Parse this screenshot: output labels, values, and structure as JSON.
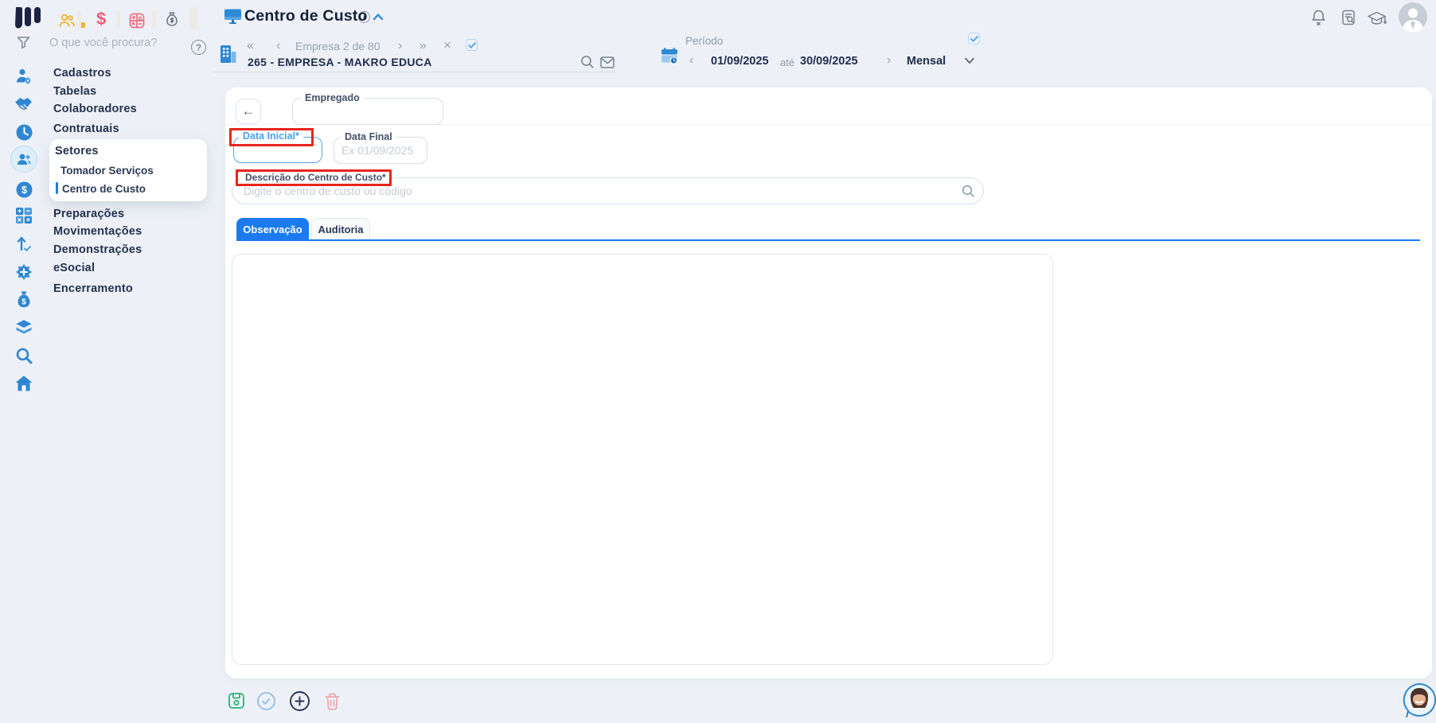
{
  "colors": {
    "accent_blue": "#1b7af0",
    "icon_blue": "#2f87d3",
    "annotation_red": "#e8241c",
    "focus_blue": "#54a3e8",
    "save_green": "#27b578",
    "delete_pink": "#f2a7ae",
    "topbar_yellow": "#f3b229",
    "topbar_pink": "#f0607a",
    "navy": "#1f2c4d",
    "page_bg": "#edf1f7"
  },
  "glyphs": {
    "first": "«",
    "prev": "‹",
    "next": "›",
    "last": "»",
    "close": "×",
    "back": "←",
    "dollar": "$",
    "question": "?",
    "info": "i"
  },
  "sidebar": {
    "search_placeholder": "O que você procura?",
    "items_top": [
      "Cadastros",
      "Tabelas",
      "Colaboradores",
      "Contratuais"
    ],
    "setores": {
      "label": "Setores",
      "children": [
        "Tomador Serviços",
        "Centro de Custo"
      ],
      "active_child": "Centro de Custo"
    },
    "items_bottom": [
      "Preparações",
      "Movimentações",
      "Demonstrações",
      "eSocial",
      "Encerramento"
    ]
  },
  "header": {
    "title": "Centro de Custo",
    "company": {
      "position": "Empresa 2 de 80",
      "name": "265 - EMPRESA - MAKRO EDUCA"
    },
    "period": {
      "label": "Período",
      "start": "01/09/2025",
      "until": "até",
      "end": "30/09/2025",
      "mode": "Mensal"
    }
  },
  "form": {
    "empregado_label": "Empregado",
    "data_inicial_label": "Data Inicial*",
    "data_inicial_value": "",
    "data_final_label": "Data Final",
    "data_final_placeholder": "Ex 01/09/2025",
    "descricao_label": "Descrição do Centro de Custo*",
    "descricao_placeholder": "Digite o centro de custo ou código"
  },
  "tabs": [
    {
      "label": "Observação",
      "active": true
    },
    {
      "label": "Auditoria",
      "active": false
    }
  ]
}
